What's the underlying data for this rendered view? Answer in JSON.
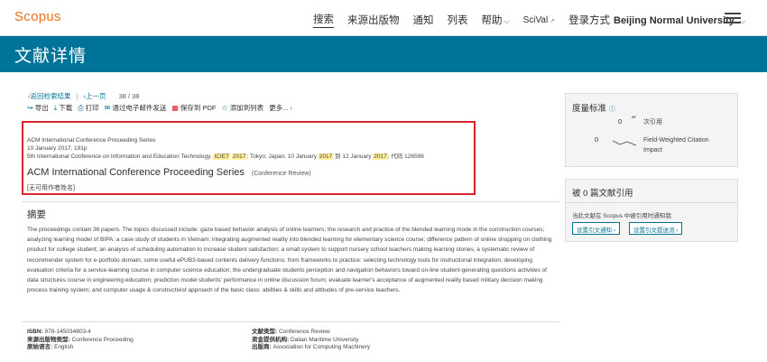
{
  "brand": "Scopus",
  "nav": {
    "search": "搜索",
    "sources": "来源出版物",
    "alerts": "通知",
    "lists": "列表",
    "help": "帮助",
    "scival": "SciVal",
    "login_prefix": "登录方式",
    "institution": "Beijing Normal University"
  },
  "banner_title": "文献详情",
  "breadcrumb": {
    "back": "返回检索结果",
    "previous": "上一页",
    "count": "38 / 38"
  },
  "toolbar": {
    "export": "导出",
    "download": "下载",
    "print": "打印",
    "email": "通过电子邮件发送",
    "save_pdf": "保存到 PDF",
    "add_list": "添加到列表",
    "more": "更多..."
  },
  "record": {
    "source_line": "ACM International Conference Proceeding Series",
    "date_line": "10 January 2017, 191p",
    "conf_pre": "5th International Conference on Information and Education Technology, ",
    "conf_hl1": "ICIET",
    "conf_hl2": "2017",
    "conf_mid1": "; Tokyo; Japan; 10 January ",
    "conf_hl3": "2017",
    "conf_mid2": " 到 12 January ",
    "conf_hl4": "2017",
    "conf_post": "; 代码 126596",
    "title": "ACM International Conference Proceeding Series",
    "doc_type": "(Conference Review)",
    "no_author": "[无可用作者姓名]"
  },
  "abstract": {
    "heading": "摘要",
    "text": "The proceedings contain 36 papers. The topics discussed include: gaze based behavior analysis of online learners; the research and practice of the blended learning mode in the construction courses; analyzing learning model of BIPA: a case study of students in Vietnam; integrating augmented reality into blended learning for elementary science course; difference pattern of online shopping on clothing product for college student; an analysis of scheduling automation to increase student satisfaction; a small system to support nursery school teachers making learning stories; a systematic review of recommender system for e-portfolio domain; some useful ePUB3-based contents delivery functions; from frameworks to practice: selecting technology tools for instructional integration; developing evaluation criteria for a service-learning course in computer science education; the undergraduate students perception and navigation behaviors toward on-line student-generating questions activities of data structures course in engineering education; prediction model students' performance in online discussion forum; evaluate learner's acceptance of augmented reality based military decision making process training system; and computer usage & constructivist approach of the basic class: abilities & skills and attitudes of pre-service teachers."
  },
  "details": {
    "isbn_label": "ISBN:",
    "isbn": "978-145034803-4",
    "source_type_label": "来源出版物类型:",
    "source_type": "Conference Proceeding",
    "language_label": "原始语言:",
    "language": "English",
    "doc_type_label": "文献类型:",
    "doc_type": "Conference Review",
    "funder_label": "资金提供机构:",
    "funder": "Dalian Maritime University",
    "publisher_label": "出版商:",
    "publisher": "Association for Computing Machinery"
  },
  "metrics": {
    "heading": "度量标准",
    "citations_value": "0",
    "citations_label": "次引用",
    "fwci_value": "0",
    "fwci_label_1": "Field-Weighted Citation",
    "fwci_label_2": "Impact"
  },
  "cited": {
    "heading": "被 0 篇文献引用",
    "sub": "当此文献在 Scopus 中被引用时通知我:",
    "alert_btn": "设置引文通知",
    "feed_btn": "设置引文提送流"
  },
  "colors": {
    "accent": "#007398",
    "brand": "#e9711c",
    "highlight_box": "#d9252c",
    "highlight_text": "#ffef98"
  }
}
